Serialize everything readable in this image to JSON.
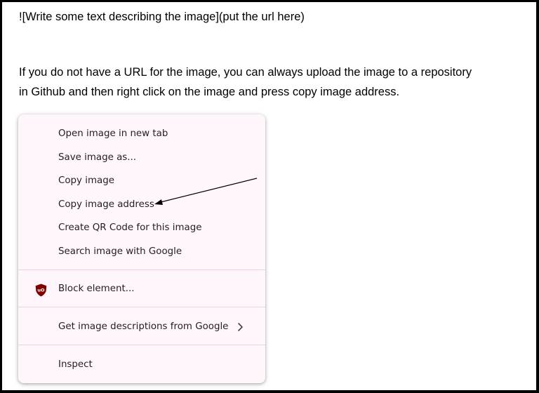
{
  "doc": {
    "line1": "![Write some text describing the image](put the url here)",
    "line2": "If you do not have a URL for the image, you can always upload the image to a repository",
    "line3": "in Github and then right click on the image and press copy image address."
  },
  "context_menu": {
    "items": [
      {
        "label": "Open image in new tab"
      },
      {
        "label": "Save image as..."
      },
      {
        "label": "Copy image"
      },
      {
        "label": "Copy image address"
      },
      {
        "label": "Create QR Code for this image"
      },
      {
        "label": "Search image with Google"
      },
      {
        "label": "Block element...",
        "icon": "ublock-origin-icon"
      },
      {
        "label": "Get image descriptions from Google",
        "icon": "chevron-right-icon"
      },
      {
        "label": "Inspect"
      }
    ]
  },
  "colors": {
    "menu_background": "#fff6fb",
    "separator": "#f1cfe0",
    "ublock_red": "#800000",
    "text": "#1f1f1f"
  }
}
